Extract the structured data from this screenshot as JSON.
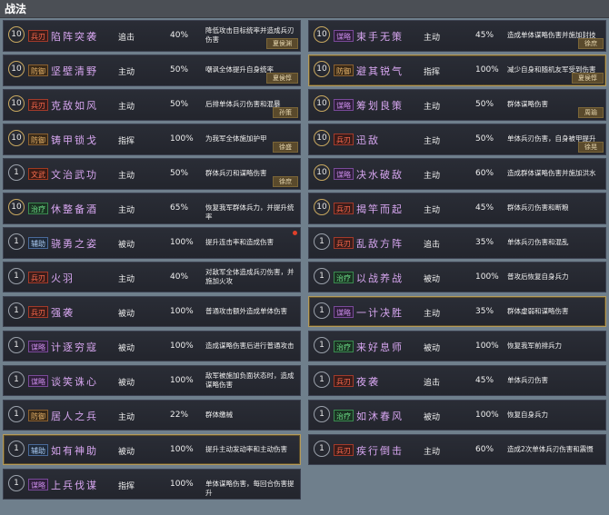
{
  "page": {
    "title": "战法"
  },
  "left": [
    {
      "level": "10",
      "tag": "兵刃",
      "tag_class": "t-ps",
      "name": "陷阵突袭",
      "type": "追击",
      "rate": "40%",
      "desc": "降低攻击目标统率并造成兵刃伤害",
      "badge": "夏侯渊",
      "hl": false
    },
    {
      "level": "10",
      "tag": "防御",
      "tag_class": "t-fy",
      "name": "坚壁清野",
      "type": "主动",
      "rate": "50%",
      "desc": "嘲讽全体提升自身统率",
      "badge": "夏侯惇",
      "hl": false
    },
    {
      "level": "10",
      "tag": "兵刃",
      "tag_class": "t-ps",
      "name": "克敌如风",
      "type": "主动",
      "rate": "50%",
      "desc": "后排单体兵刃伤害和混暴",
      "badge": "孙策",
      "hl": false
    },
    {
      "level": "10",
      "tag": "防御",
      "tag_class": "t-fy",
      "name": "铸甲锁戈",
      "type": "指挥",
      "rate": "100%",
      "desc": "为我军全体施加护甲",
      "badge": "徐盛",
      "hl": false
    },
    {
      "level": "1",
      "tag": "文武",
      "tag_class": "t-zs",
      "name": "文治武功",
      "type": "主动",
      "rate": "50%",
      "desc": "群体兵刃和谋略伤害",
      "badge": "徐庶",
      "hl": false
    },
    {
      "level": "10",
      "tag": "治疗",
      "tag_class": "t-zl",
      "name": "休整备酒",
      "type": "主动",
      "rate": "65%",
      "desc": "恢复我军群体兵力，并提升统率",
      "badge": "",
      "hl": false
    },
    {
      "level": "1",
      "tag": "辅助",
      "tag_class": "t-fz",
      "name": "骁勇之姿",
      "type": "被动",
      "rate": "100%",
      "desc": "提升连击率和造成伤害",
      "badge": "",
      "hl": false,
      "dot": true
    },
    {
      "level": "1",
      "tag": "兵刃",
      "tag_class": "t-ps",
      "name": "火羽",
      "type": "主动",
      "rate": "40%",
      "desc": "对敌军全体造成兵刃伤害，并施加火攻",
      "badge": "",
      "hl": false
    },
    {
      "level": "1",
      "tag": "兵刃",
      "tag_class": "t-ps",
      "name": "强袭",
      "type": "被动",
      "rate": "100%",
      "desc": "普通攻击额外造成单体伤害",
      "badge": "",
      "hl": false
    },
    {
      "level": "1",
      "tag": "谋略",
      "tag_class": "t-ml",
      "name": "计逐穷寇",
      "type": "被动",
      "rate": "100%",
      "desc": "造成谋略伤害后进行普通攻击",
      "badge": "",
      "hl": false
    },
    {
      "level": "1",
      "tag": "谋略",
      "tag_class": "t-ml",
      "name": "谈笑诛心",
      "type": "被动",
      "rate": "100%",
      "desc": "敌军被施加负面状态时，造成谋略伤害",
      "badge": "",
      "hl": false
    },
    {
      "level": "1",
      "tag": "防御",
      "tag_class": "t-fy",
      "name": "居人之兵",
      "type": "主动",
      "rate": "22%",
      "desc": "群体缴械",
      "badge": "",
      "hl": false
    },
    {
      "level": "1",
      "tag": "辅助",
      "tag_class": "t-fz",
      "name": "如有神助",
      "type": "被动",
      "rate": "100%",
      "desc": "提升主动发动率和主动伤害",
      "badge": "",
      "hl": true
    },
    {
      "level": "1",
      "tag": "谋略",
      "tag_class": "t-ml",
      "name": "上兵伐谋",
      "type": "指挥",
      "rate": "100%",
      "desc": "单体谋略伤害，每回合伤害提升",
      "badge": "",
      "hl": false
    }
  ],
  "right": [
    {
      "level": "10",
      "tag": "谋略",
      "tag_class": "t-ml",
      "name": "束手无策",
      "type": "主动",
      "rate": "45%",
      "desc": "造成单体谋略伤害并施加封技",
      "badge": "徐庶",
      "hl": false
    },
    {
      "level": "10",
      "tag": "防御",
      "tag_class": "t-fy",
      "name": "避其锐气",
      "type": "指挥",
      "rate": "100%",
      "desc": "减少自身和随机友军受到伤害",
      "badge": "夏侯惇",
      "hl": true
    },
    {
      "level": "10",
      "tag": "谋略",
      "tag_class": "t-ml",
      "name": "筹划良策",
      "type": "主动",
      "rate": "50%",
      "desc": "群体谋略伤害",
      "badge": "周瑜",
      "hl": false
    },
    {
      "level": "10",
      "tag": "兵刃",
      "tag_class": "t-ps",
      "name": "迅敌",
      "type": "主动",
      "rate": "50%",
      "desc": "单体兵刃伤害，自身被甲提升",
      "badge": "徐晃",
      "hl": false
    },
    {
      "level": "10",
      "tag": "谋略",
      "tag_class": "t-ml",
      "name": "决水破敌",
      "type": "主动",
      "rate": "60%",
      "desc": "造成群体谋略伤害并施加洪水",
      "badge": "",
      "hl": false
    },
    {
      "level": "10",
      "tag": "兵刃",
      "tag_class": "t-ps",
      "name": "揭竿而起",
      "type": "主动",
      "rate": "45%",
      "desc": "群体兵刃伤害和断粮",
      "badge": "",
      "hl": false
    },
    {
      "level": "1",
      "tag": "兵刃",
      "tag_class": "t-ps",
      "name": "乱敌方阵",
      "type": "追击",
      "rate": "35%",
      "desc": "单体兵刃伤害和混乱",
      "badge": "",
      "hl": false
    },
    {
      "level": "1",
      "tag": "治疗",
      "tag_class": "t-zl",
      "name": "以战养战",
      "type": "被动",
      "rate": "100%",
      "desc": "普攻后恢复自身兵力",
      "badge": "",
      "hl": false
    },
    {
      "level": "1",
      "tag": "谋略",
      "tag_class": "t-ml",
      "name": "一计决胜",
      "type": "主动",
      "rate": "35%",
      "desc": "群体虚弱和谋略伤害",
      "badge": "",
      "hl": true
    },
    {
      "level": "1",
      "tag": "治疗",
      "tag_class": "t-zl",
      "name": "来好息师",
      "type": "被动",
      "rate": "100%",
      "desc": "恢复我军前排兵力",
      "badge": "",
      "hl": false
    },
    {
      "level": "1",
      "tag": "兵刃",
      "tag_class": "t-ps",
      "name": "夜袭",
      "type": "追击",
      "rate": "45%",
      "desc": "单体兵刃伤害",
      "badge": "",
      "hl": false
    },
    {
      "level": "1",
      "tag": "治疗",
      "tag_class": "t-zl",
      "name": "如沐春风",
      "type": "被动",
      "rate": "100%",
      "desc": "恢复自身兵力",
      "badge": "",
      "hl": false
    },
    {
      "level": "1",
      "tag": "兵刃",
      "tag_class": "t-ps",
      "name": "疾行倒击",
      "type": "主动",
      "rate": "60%",
      "desc": "造成2次单体兵刃伤害和震慑",
      "badge": "",
      "hl": false
    }
  ]
}
